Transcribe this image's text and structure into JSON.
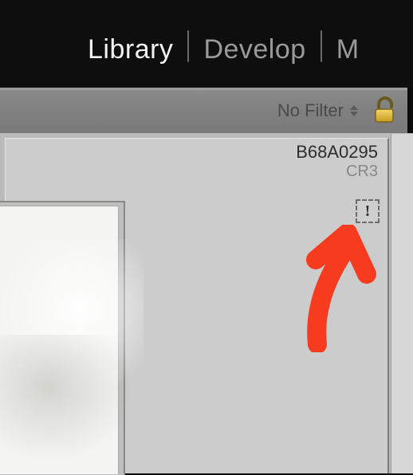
{
  "modules": {
    "library": "Library",
    "develop": "Develop",
    "third_partial": "M"
  },
  "filter": {
    "label": "No Filter"
  },
  "cell": {
    "filename": "B68A0295",
    "format": "CR3",
    "missing_glyph": "!"
  }
}
